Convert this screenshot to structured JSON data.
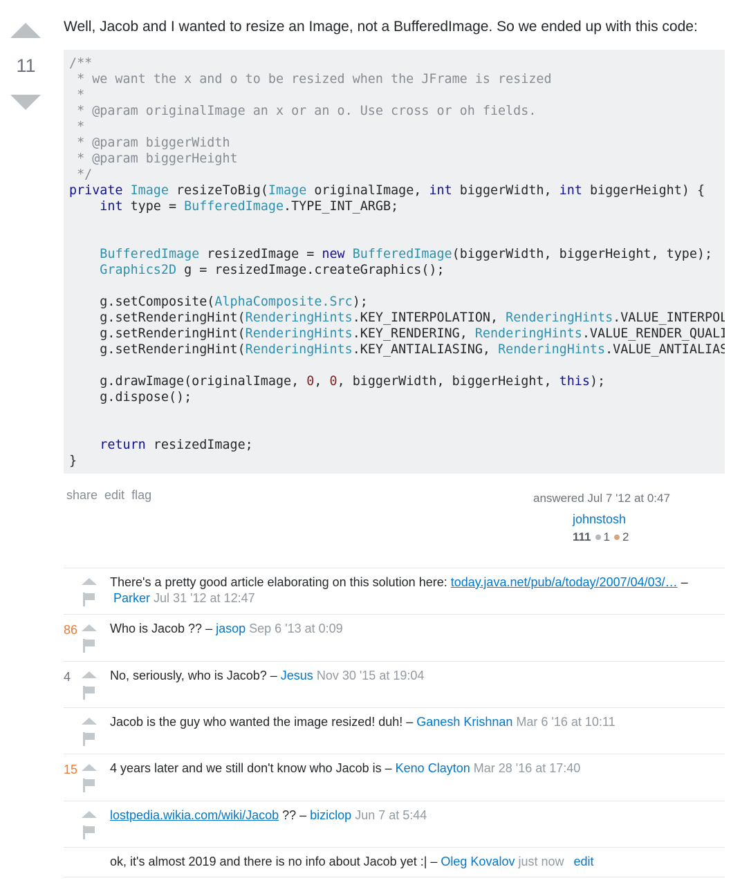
{
  "answer": {
    "score": "11",
    "intro": "Well, Jacob and I wanted to resize an Image, not a BufferedImage. So we ended up with this code:",
    "menu": {
      "share": "share",
      "edit": "edit",
      "flag": "flag"
    },
    "signature": {
      "action_time": "answered Jul 7 '12 at 0:47",
      "user": "johnstosh",
      "reputation": "111",
      "silver": "1",
      "bronze": "2",
      "silver_color": "#b4b8bc",
      "bronze_color": "#d1a684"
    }
  },
  "comments": [
    {
      "score": "",
      "text": "There's a pretty good article elaborating on this solution here: ",
      "link": "today.java.net/pub/a/today/2007/04/03/…",
      "dash": " –",
      "user": "Parker",
      "date": "Jul 31 '12 at 12:47"
    },
    {
      "score": "86",
      "text": "Who is Jacob ?? – ",
      "link": "",
      "dash": "",
      "user": "jasop",
      "date": "Sep 6 '13 at 0:09"
    },
    {
      "score": "4",
      "text": "No, seriously, who is Jacob? – ",
      "link": "",
      "dash": "",
      "user": "Jesus",
      "date": "Nov 30 '15 at 19:04"
    },
    {
      "score": "",
      "text": "Jacob is the guy who wanted the image resized! duh! – ",
      "link": "",
      "dash": "",
      "user": "Ganesh Krishnan",
      "date": "Mar 6 '16 at 10:11"
    },
    {
      "score": "15",
      "text": "4 years later and we still don't know who Jacob is – ",
      "link": "",
      "dash": "",
      "user": "Keno Clayton",
      "date": "Mar 28 '16 at 17:40"
    },
    {
      "score": "",
      "text": "",
      "link": "lostpedia.wikia.com/wiki/Jacob",
      "dash": " ?? – ",
      "user": "biziclop",
      "date": "Jun 7 at 5:44"
    },
    {
      "score": "",
      "text": "ok, it's almost 2019 and there is no info about Jacob yet :| – ",
      "link": "",
      "dash": "",
      "user": "Oleg Kovalov",
      "date": "just now",
      "edit": "edit"
    }
  ],
  "code": {
    "c1": "/**",
    "c2": " * we want the x and o to be resized when the JFrame is resized",
    "c3": " *",
    "c4": " * @param originalImage an x or an o. Use cross or oh fields.",
    "c5": " *",
    "c6": " * @param biggerWidth",
    "c7": " * @param biggerHeight",
    "c8": " */",
    "kw_private": "private",
    "t_image": "Image",
    "sig_a": " resizeToBig(",
    "t_image2": "Image",
    "sig_b": " originalImage, ",
    "kw_int1": "int",
    "sig_c": " biggerWidth, ",
    "kw_int2": "int",
    "sig_d": " biggerHeight) {",
    "kw_int3": "int",
    "l2_a": " type = ",
    "t_bi1": "BufferedImage",
    "l2_b": ".TYPE_INT_ARGB;",
    "t_bi2": "BufferedImage",
    "l3_a": " resizedImage = ",
    "kw_new": "new",
    "t_bi3": "BufferedImage",
    "l3_b": "(biggerWidth, biggerHeight, type);",
    "t_g2d": "Graphics2D",
    "l4_a": " g = resizedImage.createGraphics();",
    "l5_a": "g.setComposite(",
    "t_ac": "AlphaComposite",
    "t_src": ".Src",
    "l5_b": ");",
    "l6_a": "g.setRenderingHint(",
    "t_rh1": "RenderingHints",
    "l6_b": ".KEY_INTERPOLATION, ",
    "t_rh2": "RenderingHints",
    "l6_c": ".VALUE_INTERPOLATION_BILINEAR);",
    "l7_a": "g.setRenderingHint(",
    "t_rh3": "RenderingHints",
    "l7_b": ".KEY_RENDERING, ",
    "t_rh4": "RenderingHints",
    "l7_c": ".VALUE_RENDER_QUALITY);",
    "l8_a": "g.setRenderingHint(",
    "t_rh5": "RenderingHints",
    "l8_b": ".KEY_ANTIALIASING, ",
    "t_rh6": "RenderingHints",
    "l8_c": ".VALUE_ANTIALIAS_ON);",
    "l9_a": "g.drawImage(originalImage, ",
    "n0a": "0",
    "l9_b": ", ",
    "n0b": "0",
    "l9_c": ", biggerWidth, biggerHeight, ",
    "kw_this": "this",
    "l9_d": ");",
    "l10": "g.dispose();",
    "kw_return": "return",
    "l11": " resizedImage;",
    "close": "}"
  }
}
